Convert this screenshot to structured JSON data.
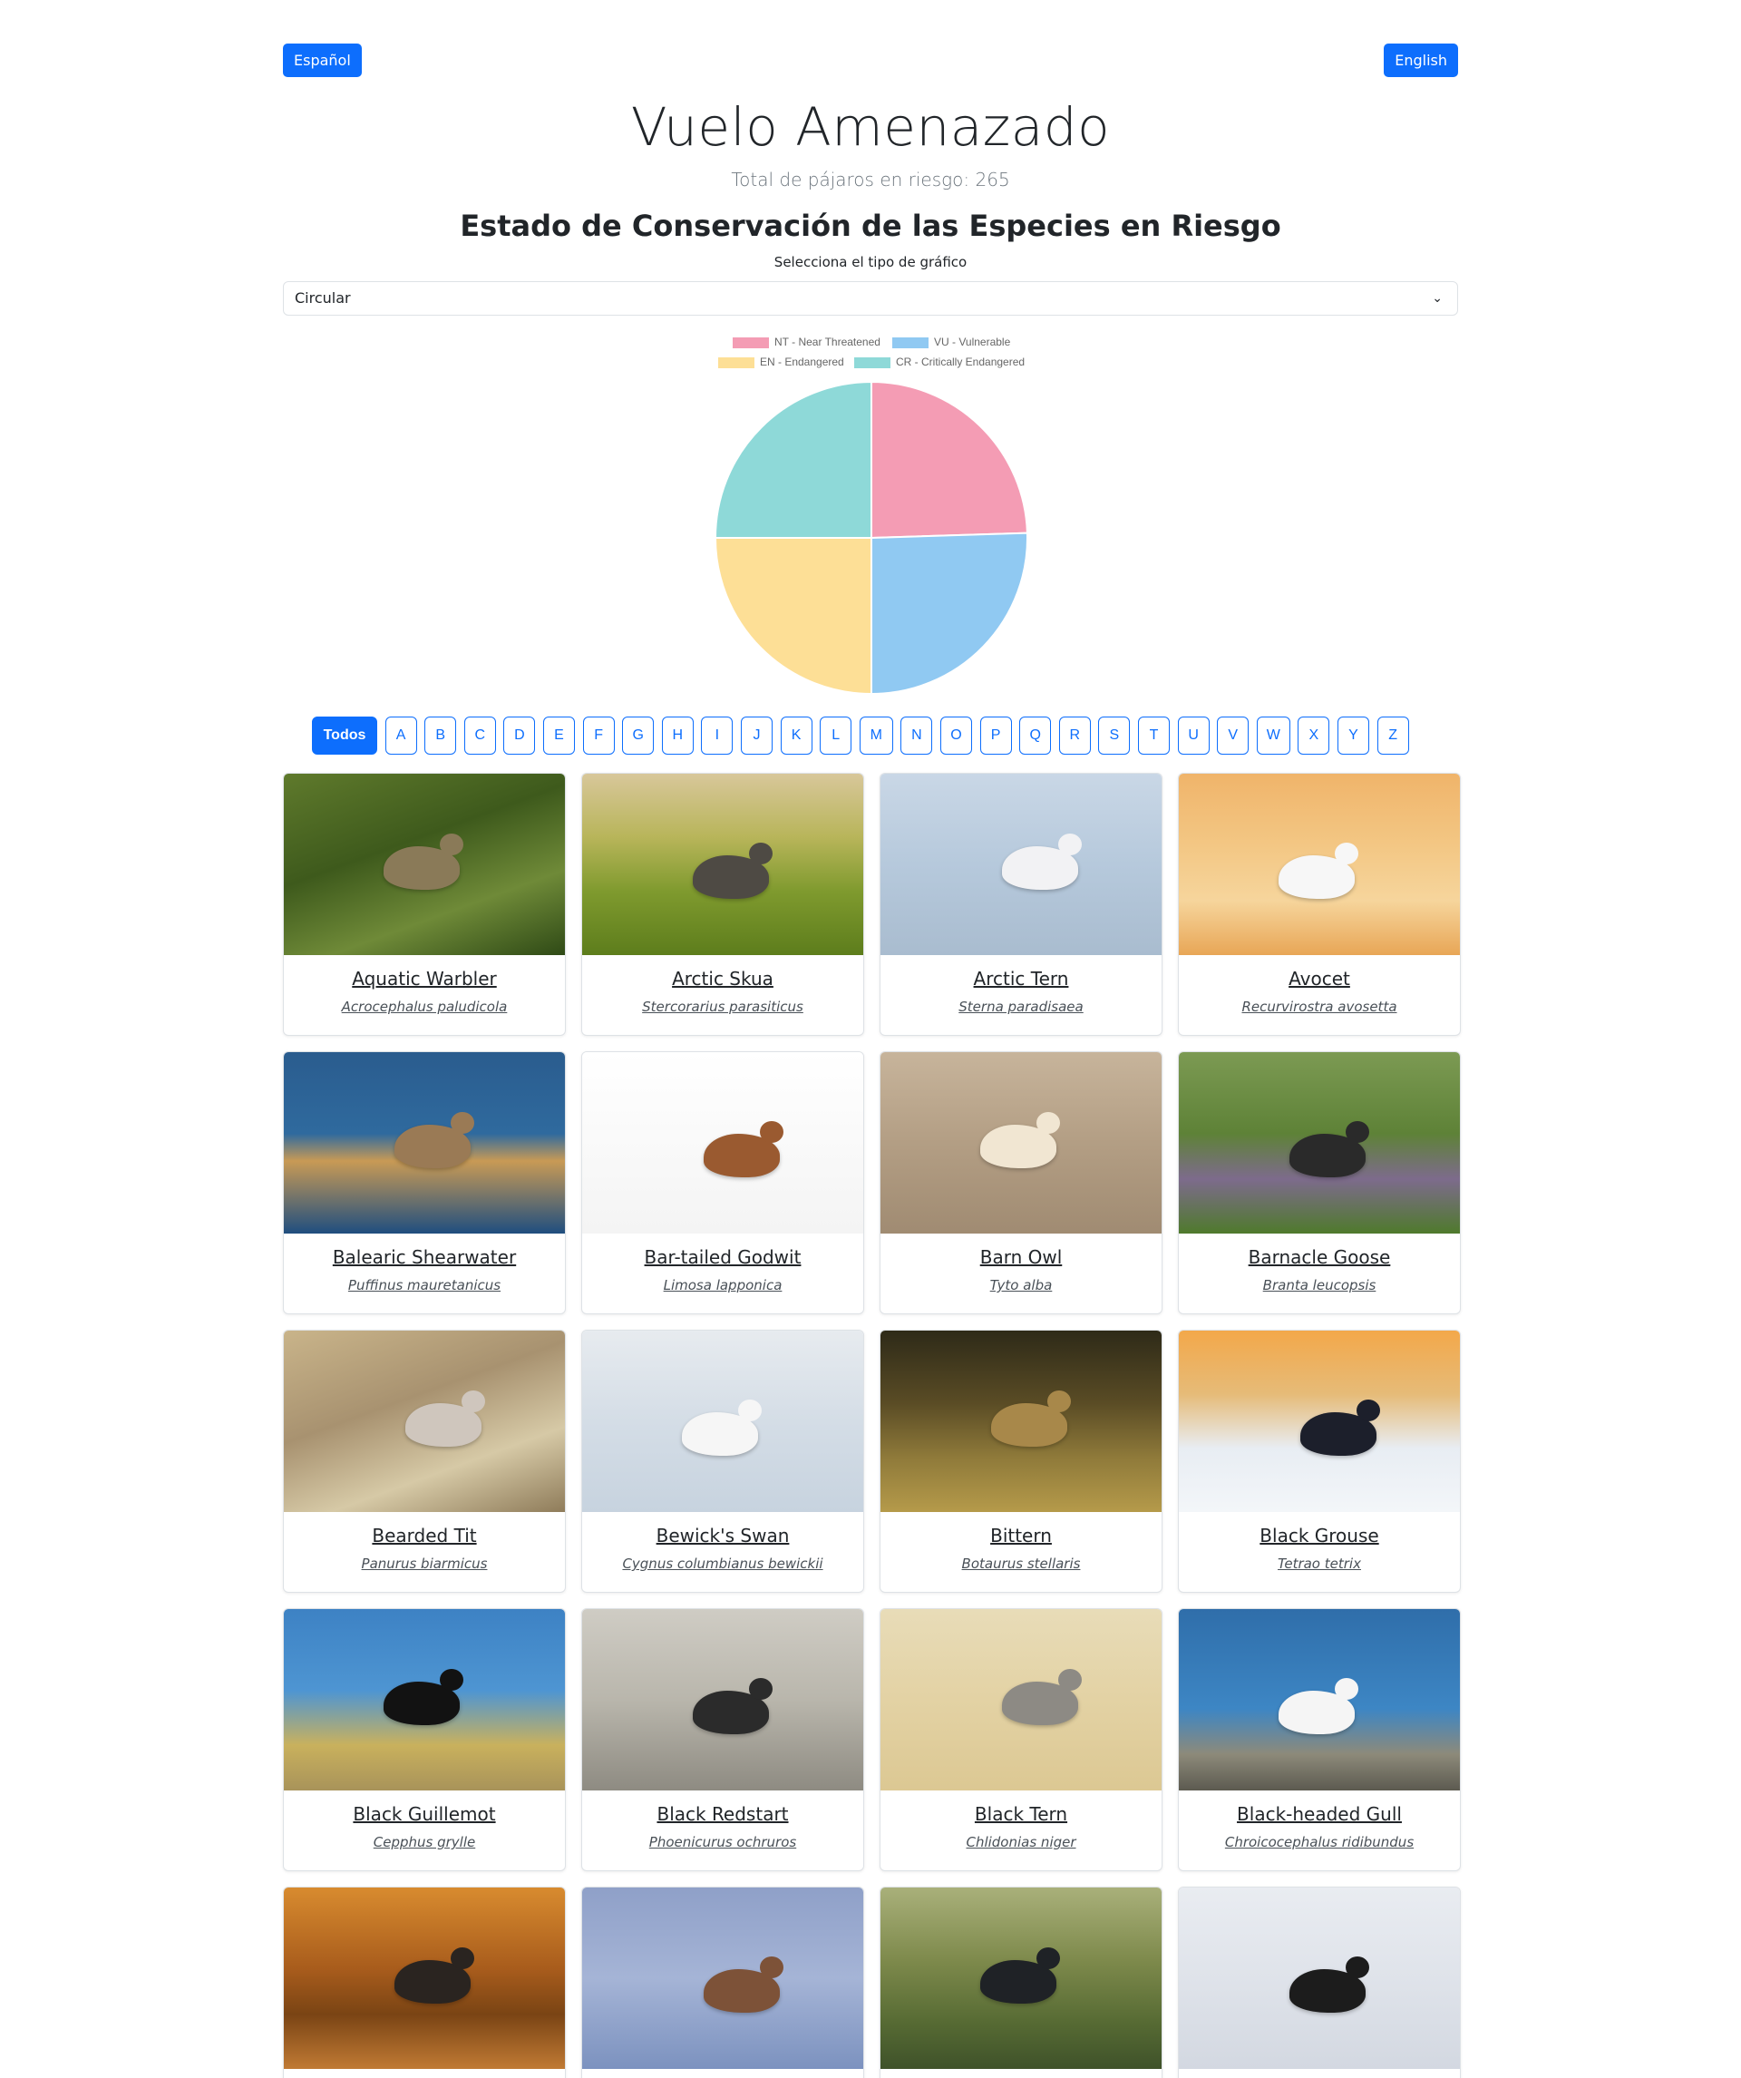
{
  "header": {
    "lang_es": "Español",
    "lang_en": "English",
    "title": "Vuelo Amenazado",
    "total": "Total de pájaros en riesgo: 265"
  },
  "chart_section": {
    "heading": "Estado de Conservación de las Especies en Riesgo",
    "select_label": "Selecciona el tipo de gráfico",
    "select_value": "Circular"
  },
  "chart_data": {
    "type": "pie",
    "labels": [
      "NT - Near Threatened",
      "VU - Vulnerable",
      "EN - Endangered",
      "CR - Critically Endangered"
    ],
    "values": [
      24.5,
      25.5,
      25,
      25
    ],
    "colors": [
      "#f49cb4",
      "#90c9f2",
      "#fddf96",
      "#8ed9d8"
    ],
    "legend_position": "top"
  },
  "filters": {
    "items": [
      "Todos",
      "A",
      "B",
      "C",
      "D",
      "E",
      "F",
      "G",
      "H",
      "I",
      "J",
      "K",
      "L",
      "M",
      "N",
      "O",
      "P",
      "Q",
      "R",
      "S",
      "T",
      "U",
      "V",
      "W",
      "X",
      "Y",
      "Z"
    ],
    "active": "Todos"
  },
  "birds": [
    {
      "name": "Aquatic Warbler",
      "sci": "Acrocephalus paludicola"
    },
    {
      "name": "Arctic Skua",
      "sci": "Stercorarius parasiticus"
    },
    {
      "name": "Arctic Tern",
      "sci": "Sterna paradisaea"
    },
    {
      "name": "Avocet",
      "sci": "Recurvirostra avosetta"
    },
    {
      "name": "Balearic Shearwater",
      "sci": "Puffinus mauretanicus"
    },
    {
      "name": "Bar-tailed Godwit",
      "sci": "Limosa lapponica"
    },
    {
      "name": "Barn Owl",
      "sci": "Tyto alba"
    },
    {
      "name": "Barnacle Goose",
      "sci": "Branta leucopsis"
    },
    {
      "name": "Bearded Tit",
      "sci": "Panurus biarmicus"
    },
    {
      "name": "Bewick's Swan",
      "sci": "Cygnus columbianus bewickii"
    },
    {
      "name": "Bittern",
      "sci": "Botaurus stellaris"
    },
    {
      "name": "Black Grouse",
      "sci": "Tetrao tetrix"
    },
    {
      "name": "Black Guillemot",
      "sci": "Cepphus grylle"
    },
    {
      "name": "Black Redstart",
      "sci": "Phoenicurus ochruros"
    },
    {
      "name": "Black Tern",
      "sci": "Chlidonias niger"
    },
    {
      "name": "Black-headed Gull",
      "sci": "Chroicocephalus ridibundus"
    },
    {
      "name": "",
      "sci": ""
    },
    {
      "name": "",
      "sci": ""
    },
    {
      "name": "",
      "sci": ""
    },
    {
      "name": "",
      "sci": ""
    }
  ],
  "images": [
    {
      "bg": "linear-gradient(160deg,#5f7a2c 0%,#3e5a1c 40%,#6f8a38 70%,#2f4a16 100%)",
      "bird": "#8a7a58"
    },
    {
      "bg": "linear-gradient(180deg,#d8c79a 0%,#b8b55a 35%,#7f9a2e 65%,#5d7d1c 100%)",
      "bird": "#4e4a44"
    },
    {
      "bg": "linear-gradient(180deg,#c9d7e6 0%,#b6c9dc 50%,#a9bccf 100%)",
      "bird": "#f2f2f4"
    },
    {
      "bg": "linear-gradient(180deg,#f0b46a 0%,#f3c784 40%,#f6d59c 70%,#e8a656 100%)",
      "bird": "#f7f7f7"
    },
    {
      "bg": "linear-gradient(180deg,#2a5c8e 0%,#2f6a9e 45%,#c89a55 60%,#1f4e7f 100%)",
      "bird": "#9a7a55"
    },
    {
      "bg": "linear-gradient(180deg,#ffffff 0%,#f4f4f4 100%)",
      "bird": "#9a5a30"
    },
    {
      "bg": "linear-gradient(180deg,#c7b49b 0%,#b39e84 50%,#a08b72 100%)",
      "bird": "#f1e6d2"
    },
    {
      "bg": "linear-gradient(180deg,#7c9a53 0%,#5e8237 45%,#7d6b8c 70%,#4f7a2c 100%)",
      "bird": "#2a2a2a"
    },
    {
      "bg": "linear-gradient(160deg,#c9b48a 0%,#a89270 40%,#d6c9a6 70%,#8f7c5a 100%)",
      "bird": "#cfc6bd"
    },
    {
      "bg": "linear-gradient(180deg,#e7ebef 0%,#d4dde6 50%,#c7d3df 100%)",
      "bird": "#f6f6f6"
    },
    {
      "bg": "linear-gradient(180deg,#2e2a18 0%,#5a4c25 40%,#8f7a3a 70%,#b59a4a 100%)",
      "bird": "#a8884a"
    },
    {
      "bg": "linear-gradient(180deg,#f3a84a 0%,#e6bb78 35%,#e8edf3 65%,#f3f6f9 100%)",
      "bird": "#1c1f2b"
    },
    {
      "bg": "linear-gradient(180deg,#3d82c4 0%,#4e95d2 45%,#c9b15d 75%,#a8935a 100%)",
      "bird": "#121212"
    },
    {
      "bg": "linear-gradient(180deg,#cfccc4 0%,#b9b6ac 50%,#8e8b82 100%)",
      "bird": "#2b2b2b"
    },
    {
      "bg": "linear-gradient(180deg,#e8dcb8 0%,#e3d2a4 50%,#dcc893 100%)",
      "bird": "#8d8a84"
    },
    {
      "bg": "linear-gradient(180deg,#2f6eaa 0%,#3d86c4 55%,#8d8a7a 80%,#5c5a50 100%)",
      "bird": "#f5f5f5"
    },
    {
      "bg": "linear-gradient(180deg,#d88b2f 0%,#a85c1c 45%,#7a4414 70%,#c07a34 100%)",
      "bird": "#2a2420"
    },
    {
      "bg": "linear-gradient(180deg,#8fa0c8 0%,#a5b4d6 50%,#7c92bf 100%)",
      "bird": "#7d5238"
    },
    {
      "bg": "linear-gradient(180deg,#a9b07a 0%,#7e8a4c 40%,#566a33 75%,#3f522a 100%)",
      "bird": "#1f2226"
    },
    {
      "bg": "linear-gradient(180deg,#e9ecf1 0%,#dfe3ea 50%,#d3d8e1 100%)",
      "bird": "#1c1c1c"
    }
  ]
}
